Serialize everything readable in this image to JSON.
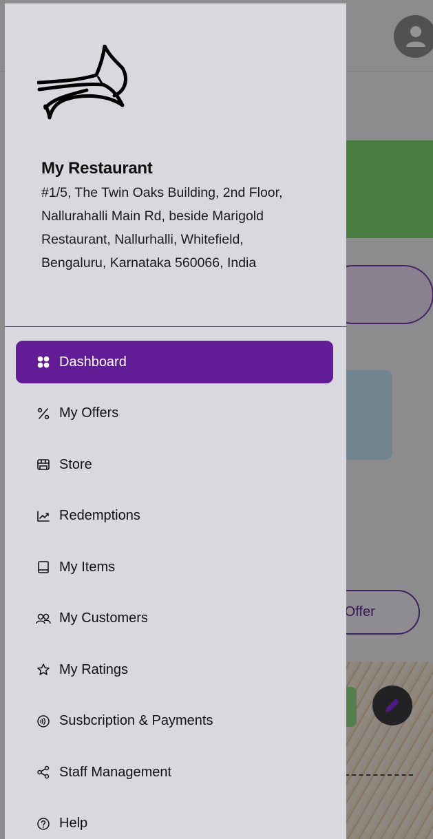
{
  "restaurant": {
    "name": "My Restaurant",
    "address": "#1/5, The Twin Oaks Building, 2nd Floor, Nallurahalli Main Rd, beside Marigold Restaurant, Nallurhalli, Whitefield, Bengaluru, Karnataka 560066, India"
  },
  "menu": {
    "items": [
      {
        "label": "Dashboard",
        "icon": "dashboard-grid-icon",
        "active": true
      },
      {
        "label": "My Offers",
        "icon": "percent-icon",
        "active": false
      },
      {
        "label": "Store",
        "icon": "store-icon",
        "active": false
      },
      {
        "label": "Redemptions",
        "icon": "trend-chart-icon",
        "active": false
      },
      {
        "label": "My Items",
        "icon": "book-icon",
        "active": false
      },
      {
        "label": "My Customers",
        "icon": "users-icon",
        "active": false
      },
      {
        "label": "My Ratings",
        "icon": "star-icon",
        "active": false
      },
      {
        "label": "Susbcription & Payments",
        "icon": "contactless-payment-icon",
        "active": false
      },
      {
        "label": "Staff Management",
        "icon": "share-network-icon",
        "active": false
      },
      {
        "label": "Help",
        "icon": "help-circle-icon",
        "active": false
      }
    ]
  },
  "background": {
    "add_offer_label": "d Offer"
  },
  "colors": {
    "active_item": "#611c96",
    "drawer_bg": "#d9d8de"
  }
}
